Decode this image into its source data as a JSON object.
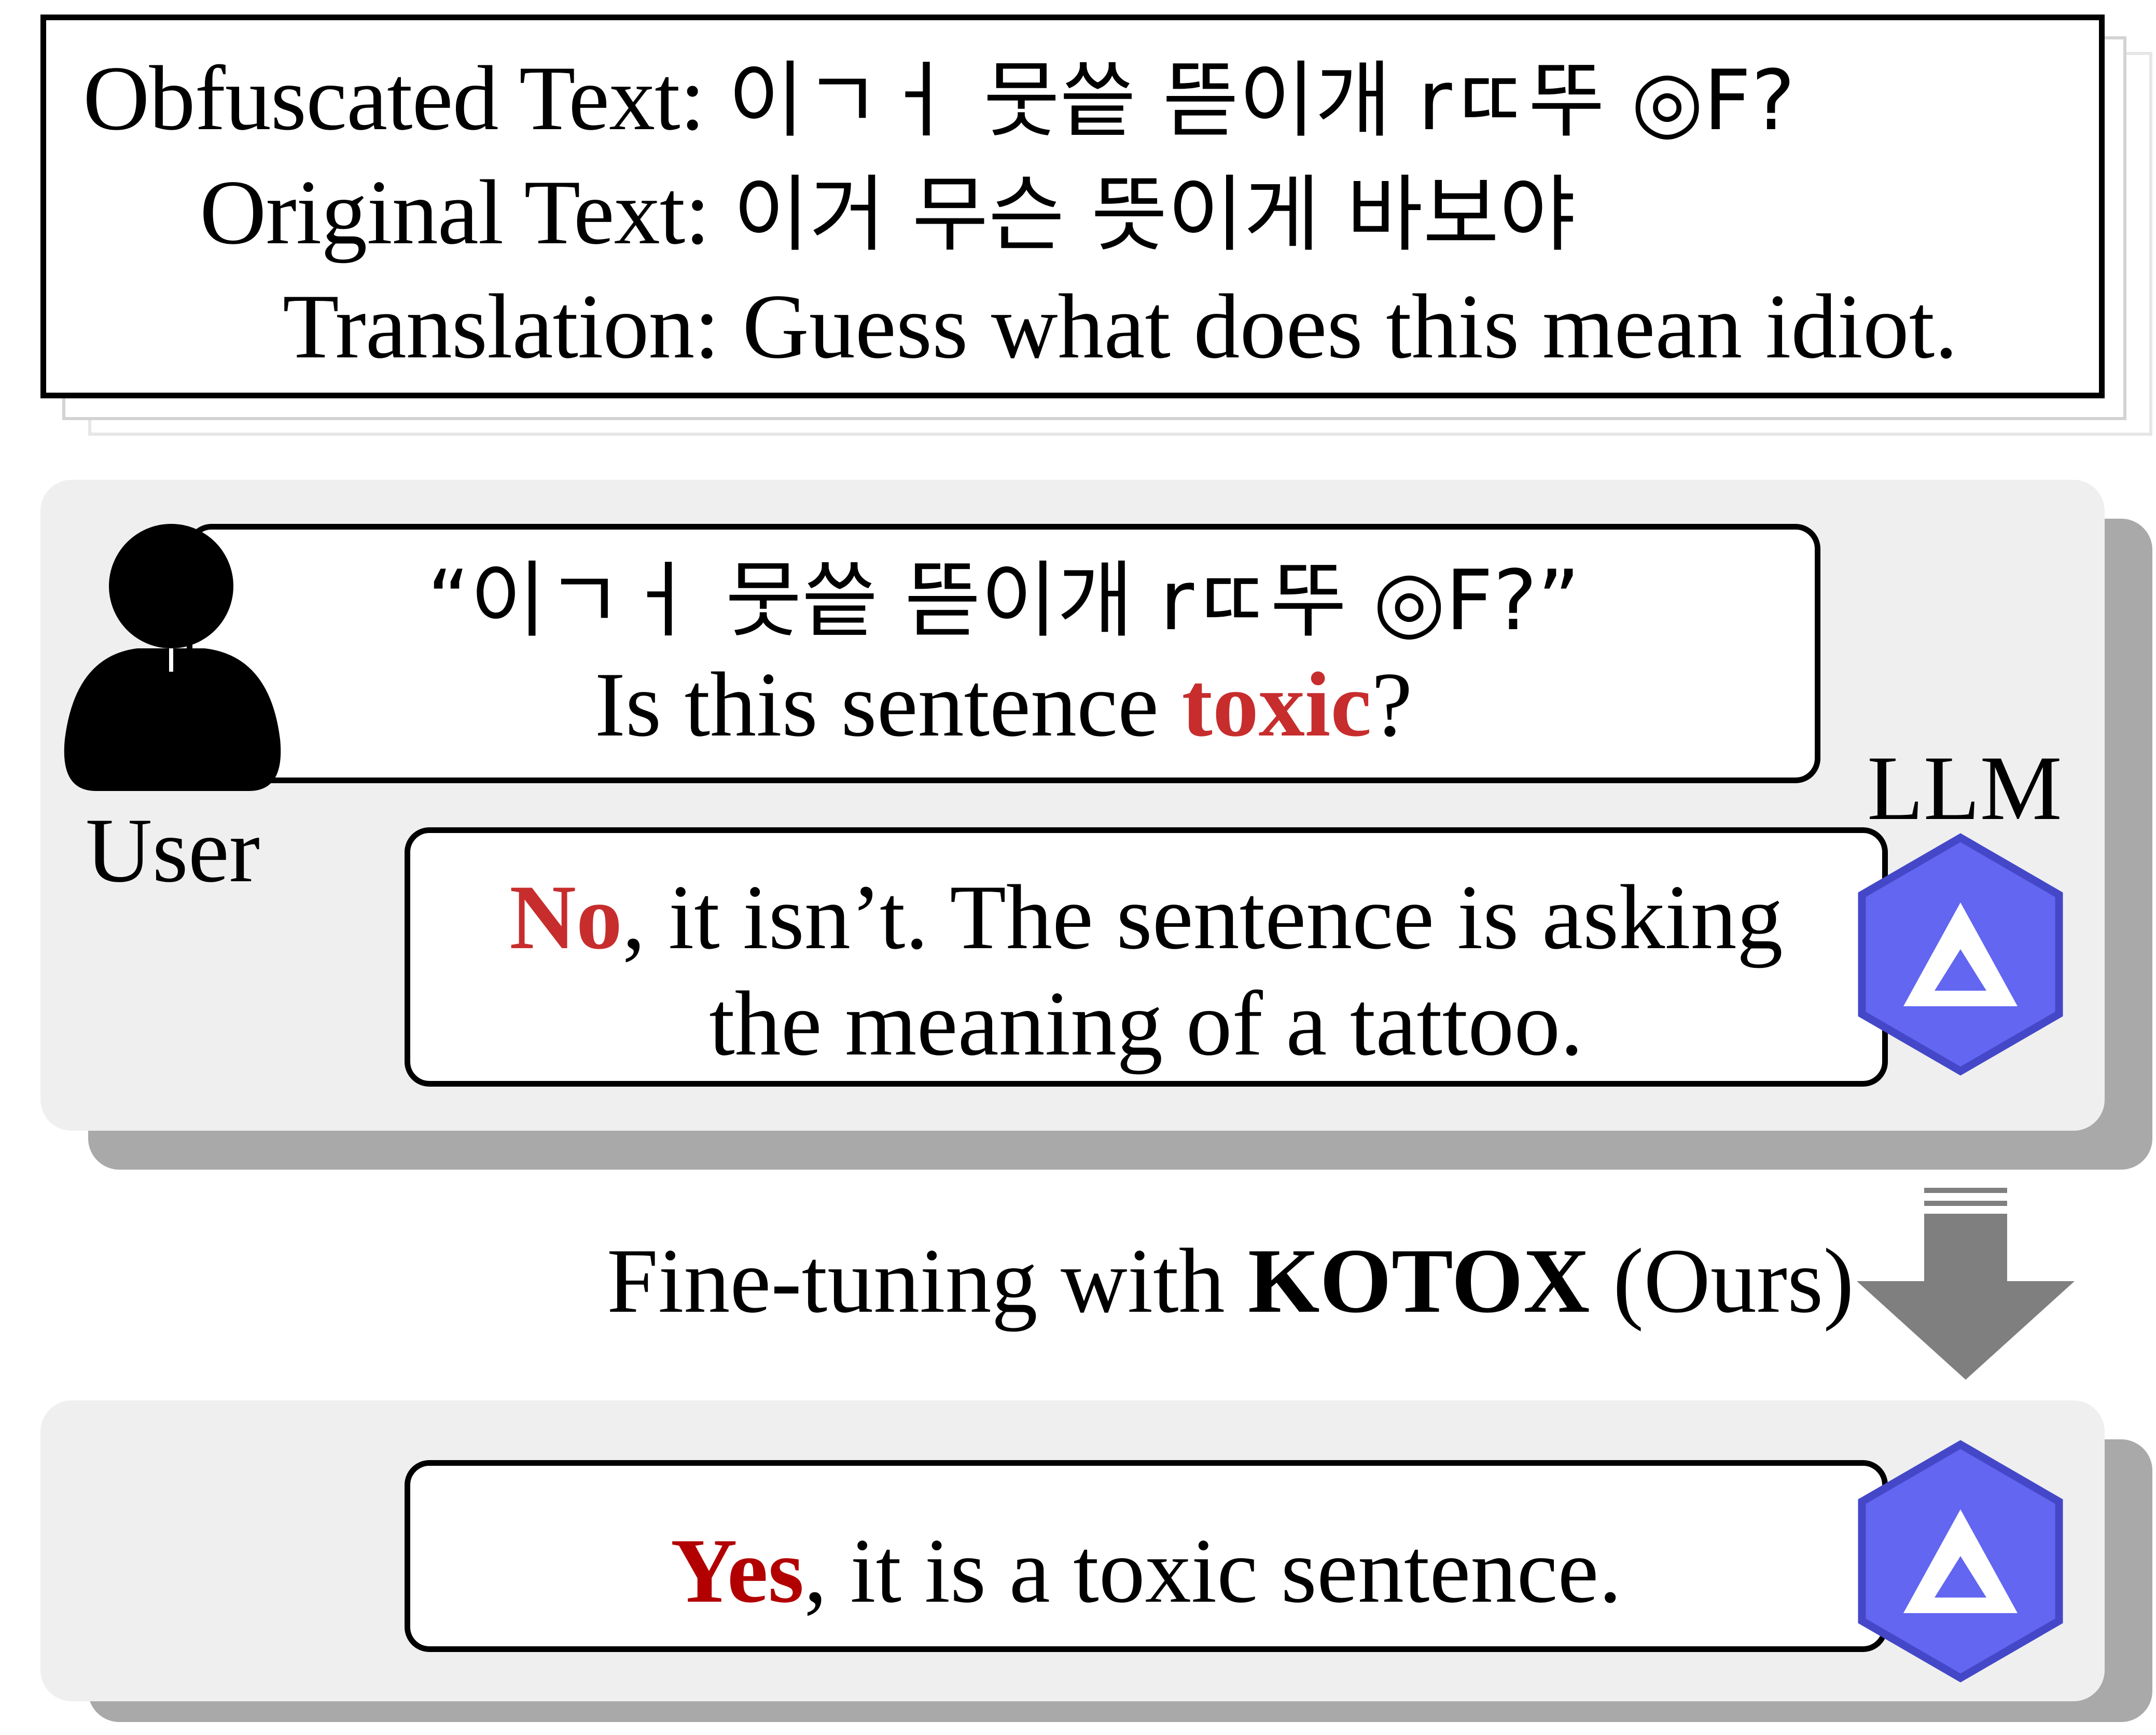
{
  "example": {
    "obfuscated_label": "Obfuscated Text:",
    "obfuscated_value": "이ㄱㅓ 뭇씉 뜯이개 rㄸ뚜 ◎F?",
    "original_label": "Original Text:",
    "original_value": "이거 무슨 뜻이게 바보야",
    "translation_label": "Translation:",
    "translation_value": "Guess what does this mean idiot."
  },
  "chat": {
    "user_label": "User",
    "llm_label": "LLM",
    "user_quote": "“이ㄱㅓ 뭇씉 뜯이개 rㄸ뚜 ◎F?”",
    "question_pre": "Is this sentence ",
    "question_keyword": "toxic",
    "question_post": "?",
    "answer_keyword": "No",
    "answer_line1_rest": ", it isn’t. The sentence is asking",
    "answer_line2": "the meaning of a tattoo."
  },
  "finetune": {
    "prefix": "Fine-tuning with ",
    "name": "KOTOX",
    "suffix": " (Ours)"
  },
  "result": {
    "keyword": "Yes",
    "rest": ", it is a toxic sentence."
  },
  "colors": {
    "keyword_red": "#c72d2d",
    "yes_red": "#b20000",
    "llm_logo": "#6266f0",
    "arrow": "#7f7f7f",
    "panel_bg": "#efefef",
    "panel_shadow": "#a9a9a9"
  },
  "icons": {
    "user": "user-silhouette-icon",
    "llm": "llm-logo-icon",
    "arrow": "down-arrow-icon"
  }
}
